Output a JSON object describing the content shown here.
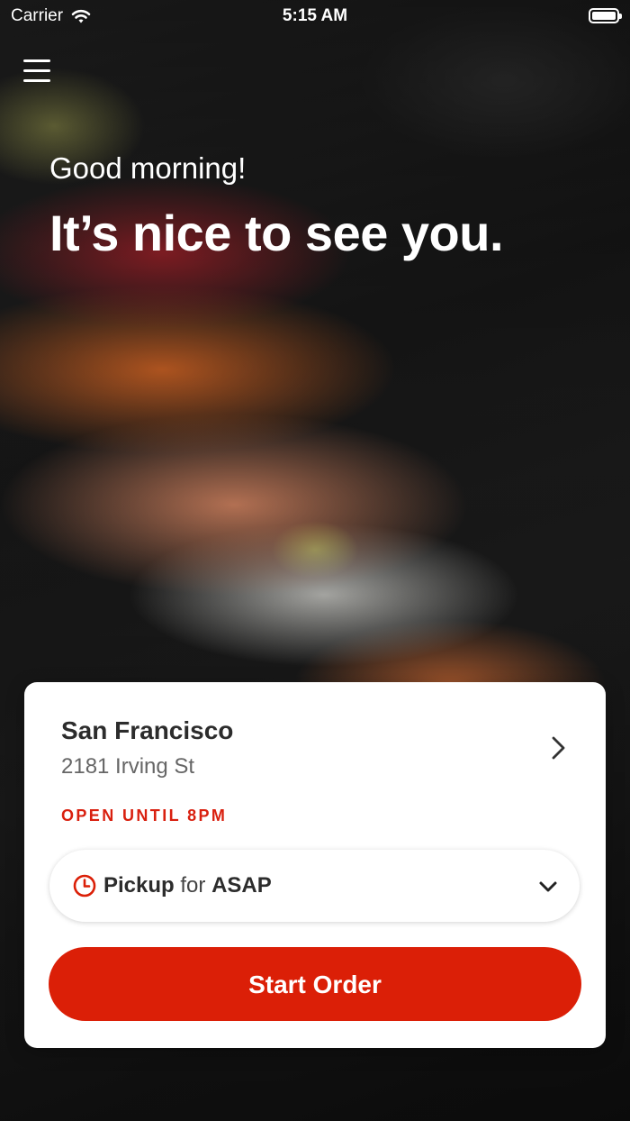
{
  "status_bar": {
    "carrier": "Carrier",
    "time": "5:15 AM"
  },
  "hero": {
    "greeting": "Good morning!",
    "headline": "It’s nice to see you."
  },
  "location": {
    "name": "San Francisco",
    "address": "2181 Irving St",
    "status": "OPEN UNTIL 8PM"
  },
  "order_mode": {
    "mode": "Pickup",
    "connector": "for",
    "time": "ASAP"
  },
  "actions": {
    "start_order": "Start Order"
  },
  "colors": {
    "accent": "#db1f07",
    "text_dark": "#2c2c2c",
    "text_muted": "#666666"
  },
  "icons": {
    "menu": "hamburger-menu-icon",
    "wifi": "wifi-icon",
    "battery": "battery-icon",
    "location_chevron": "chevron-right-icon",
    "clock": "clock-icon",
    "dropdown": "chevron-down-icon"
  }
}
